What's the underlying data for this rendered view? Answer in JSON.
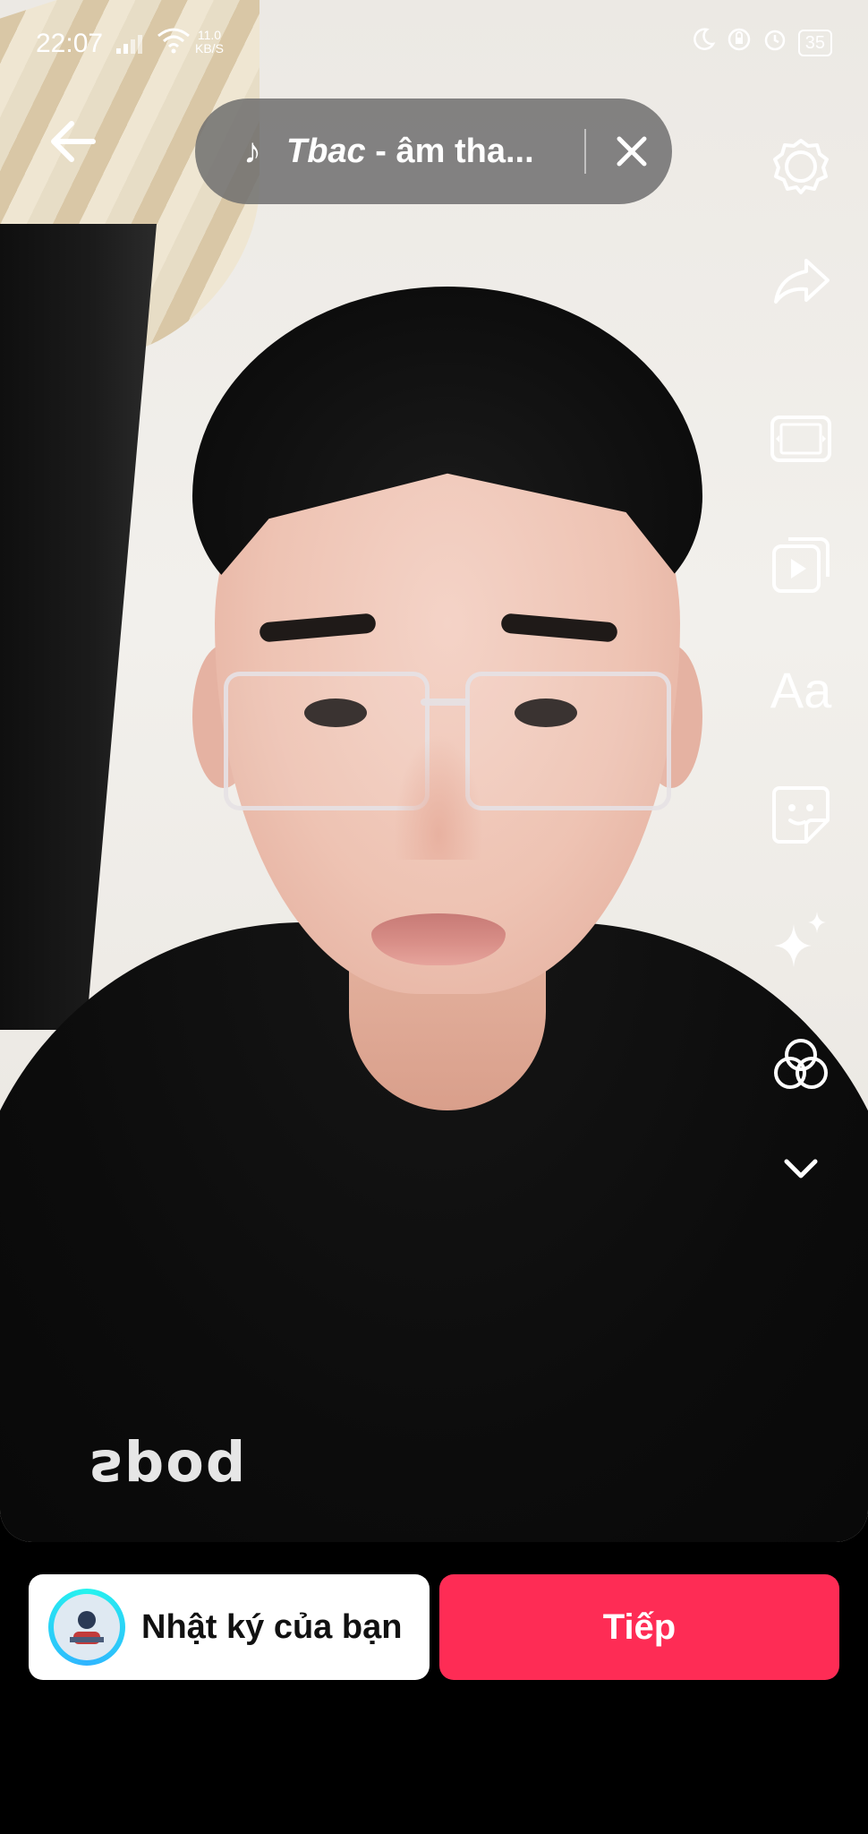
{
  "status_bar": {
    "time": "22:07",
    "net_speed_value": "11.0",
    "net_speed_unit": "KB/S",
    "battery": "35"
  },
  "sound": {
    "artist": "Tbac",
    "rest": " - âm tha..."
  },
  "tools": [
    {
      "icon": "settings-icon"
    },
    {
      "icon": "share-arrow-icon"
    },
    {
      "icon": "resize-frame-icon"
    },
    {
      "icon": "video-template-icon"
    },
    {
      "icon": "text-icon",
      "label": "Aa"
    },
    {
      "icon": "sticker-icon"
    },
    {
      "icon": "effects-sparkle-icon"
    },
    {
      "icon": "filters-icon"
    },
    {
      "icon": "chevron-down-icon"
    }
  ],
  "photo": {
    "shirt_text": "spoq"
  },
  "bottom": {
    "journal_label": "Nhật ký của bạn",
    "next_label": "Tiếp"
  },
  "colors": {
    "accent": "#fe2c55",
    "pill_bg": "#6e6e6e"
  }
}
